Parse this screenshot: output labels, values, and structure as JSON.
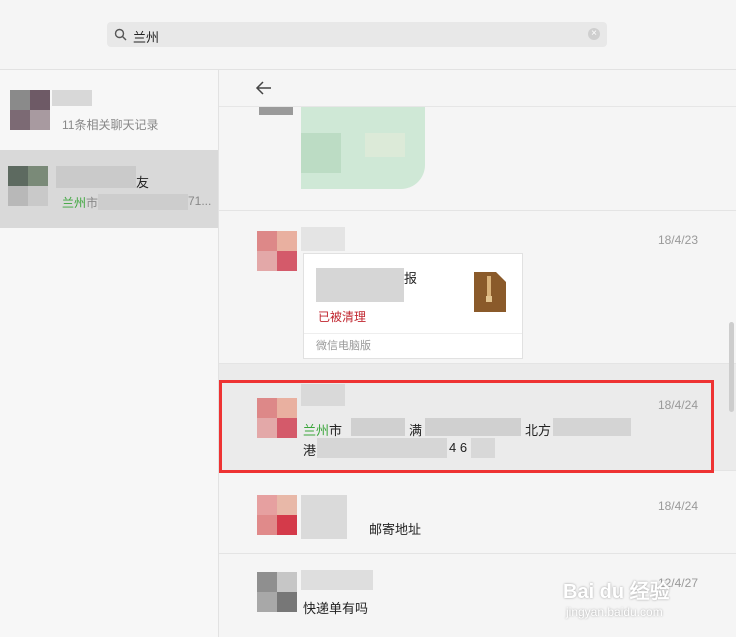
{
  "search": {
    "query": "兰州",
    "clear_label": "×"
  },
  "left_results": [
    {
      "subtitle": "11条相关聊天记录"
    },
    {
      "name_suffix": "友",
      "match": "兰州",
      "preview": "市",
      "preview_tail": "71..."
    }
  ],
  "messages": [
    {
      "date": "",
      "type": "image"
    },
    {
      "date": "18/4/23",
      "type": "file",
      "file_title": "报",
      "file_status": "已被清理",
      "file_source": "微信电脑版"
    },
    {
      "date": "18/4/24",
      "match": "兰州",
      "text_a": "市",
      "text_b": "满",
      "text_c": "北方",
      "text_d": "港",
      "text_e": "4 6"
    },
    {
      "date": "18/4/24",
      "text": "邮寄地址"
    },
    {
      "date": "12/4/27",
      "text": "快递单有吗"
    }
  ],
  "watermark": {
    "logo": "Bai du 经验",
    "url": "jingyan.baidu.com"
  },
  "colors": {
    "highlight_border": "#ee3333",
    "match_green": "#3aa53a",
    "cleared_red": "#c0262f"
  }
}
